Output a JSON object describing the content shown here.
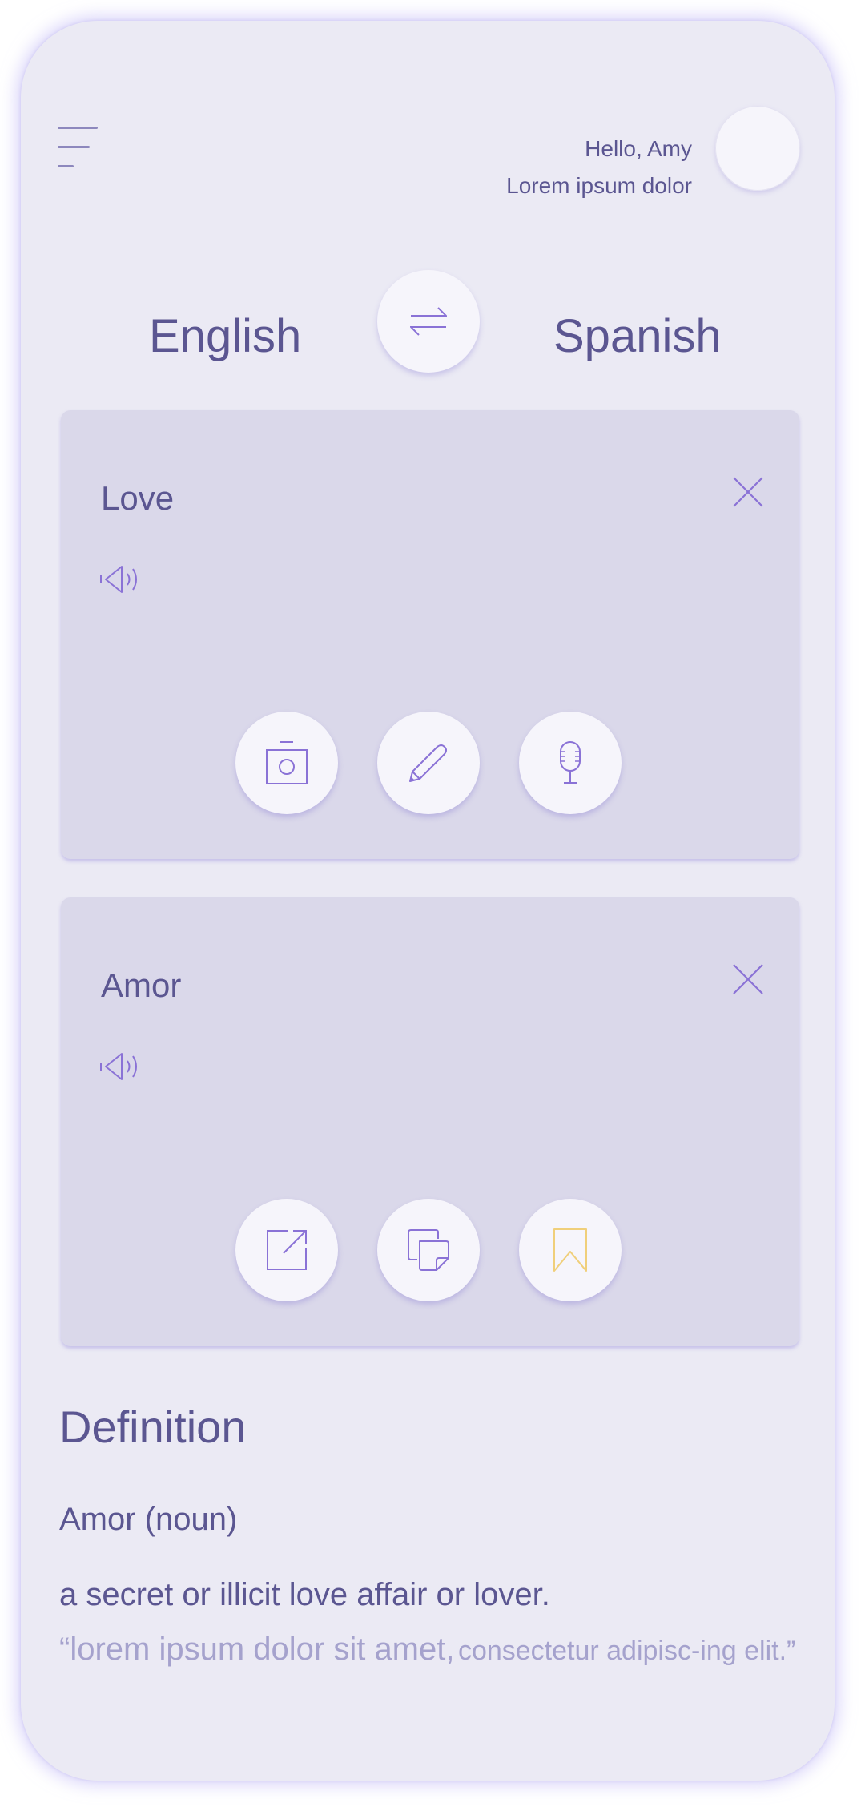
{
  "header": {
    "greeting": "Hello, Amy",
    "subtitle": "Lorem ipsum dolor"
  },
  "languages": {
    "source": "English",
    "target": "Spanish"
  },
  "source_card": {
    "word": "Love",
    "icons": [
      "speaker-icon",
      "close-icon",
      "camera-icon",
      "pencil-icon",
      "microphone-icon"
    ]
  },
  "target_card": {
    "word": "Amor",
    "icons": [
      "speaker-icon",
      "close-icon",
      "share-icon",
      "copy-icon",
      "bookmark-icon"
    ]
  },
  "definition": {
    "title": "Definition",
    "word": "Amor (noun)",
    "text": "a secret or illicit love affair or lover.",
    "example_large": "“lorem ipsum dolor sit amet,",
    "example_small": "consectetur adipisc-ing elit.”"
  },
  "colors": {
    "background": "#ebeaf4",
    "card": "#dad8ea",
    "text": "#5b5691",
    "icon": "#8a72d6",
    "bookmark": "#f0cf7a",
    "muted_text": "#a5a2cd"
  }
}
